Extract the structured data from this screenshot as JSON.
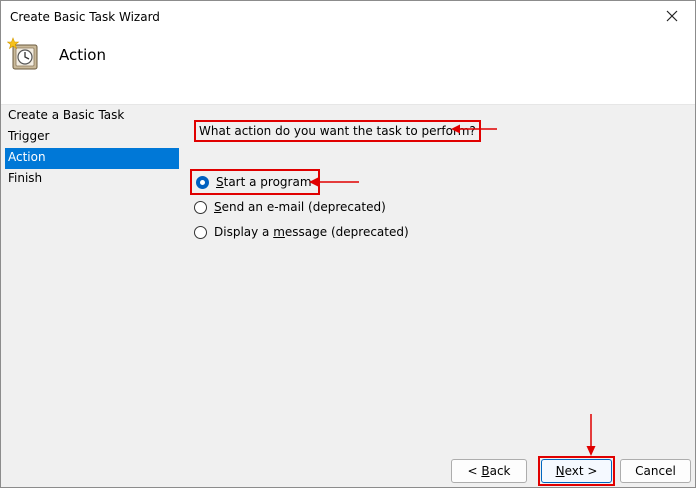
{
  "window": {
    "title": "Create Basic Task Wizard",
    "close_icon": "close-icon"
  },
  "header": {
    "title": "Action",
    "icon": "task-scheduler-clock-icon"
  },
  "nav": {
    "items": [
      {
        "label": "Create a Basic Task",
        "selected": false
      },
      {
        "label": "Trigger",
        "selected": false
      },
      {
        "label": "Action",
        "selected": true
      },
      {
        "label": "Finish",
        "selected": false
      }
    ]
  },
  "content": {
    "question": "What action do you want the task to perform?",
    "options": [
      {
        "pre": "",
        "accel": "S",
        "post": "tart a program",
        "checked": true
      },
      {
        "pre": "",
        "accel": "S",
        "post": "end an e-mail (deprecated)",
        "checked": false
      },
      {
        "pre": "Display a ",
        "accel": "m",
        "post": "essage (deprecated)",
        "checked": false
      }
    ]
  },
  "buttons": {
    "back": {
      "pre": "< ",
      "accel": "B",
      "post": "ack"
    },
    "next": {
      "pre": "",
      "accel": "N",
      "post": "ext >"
    },
    "cancel": "Cancel"
  },
  "annotation": {
    "color": "#e00000"
  }
}
